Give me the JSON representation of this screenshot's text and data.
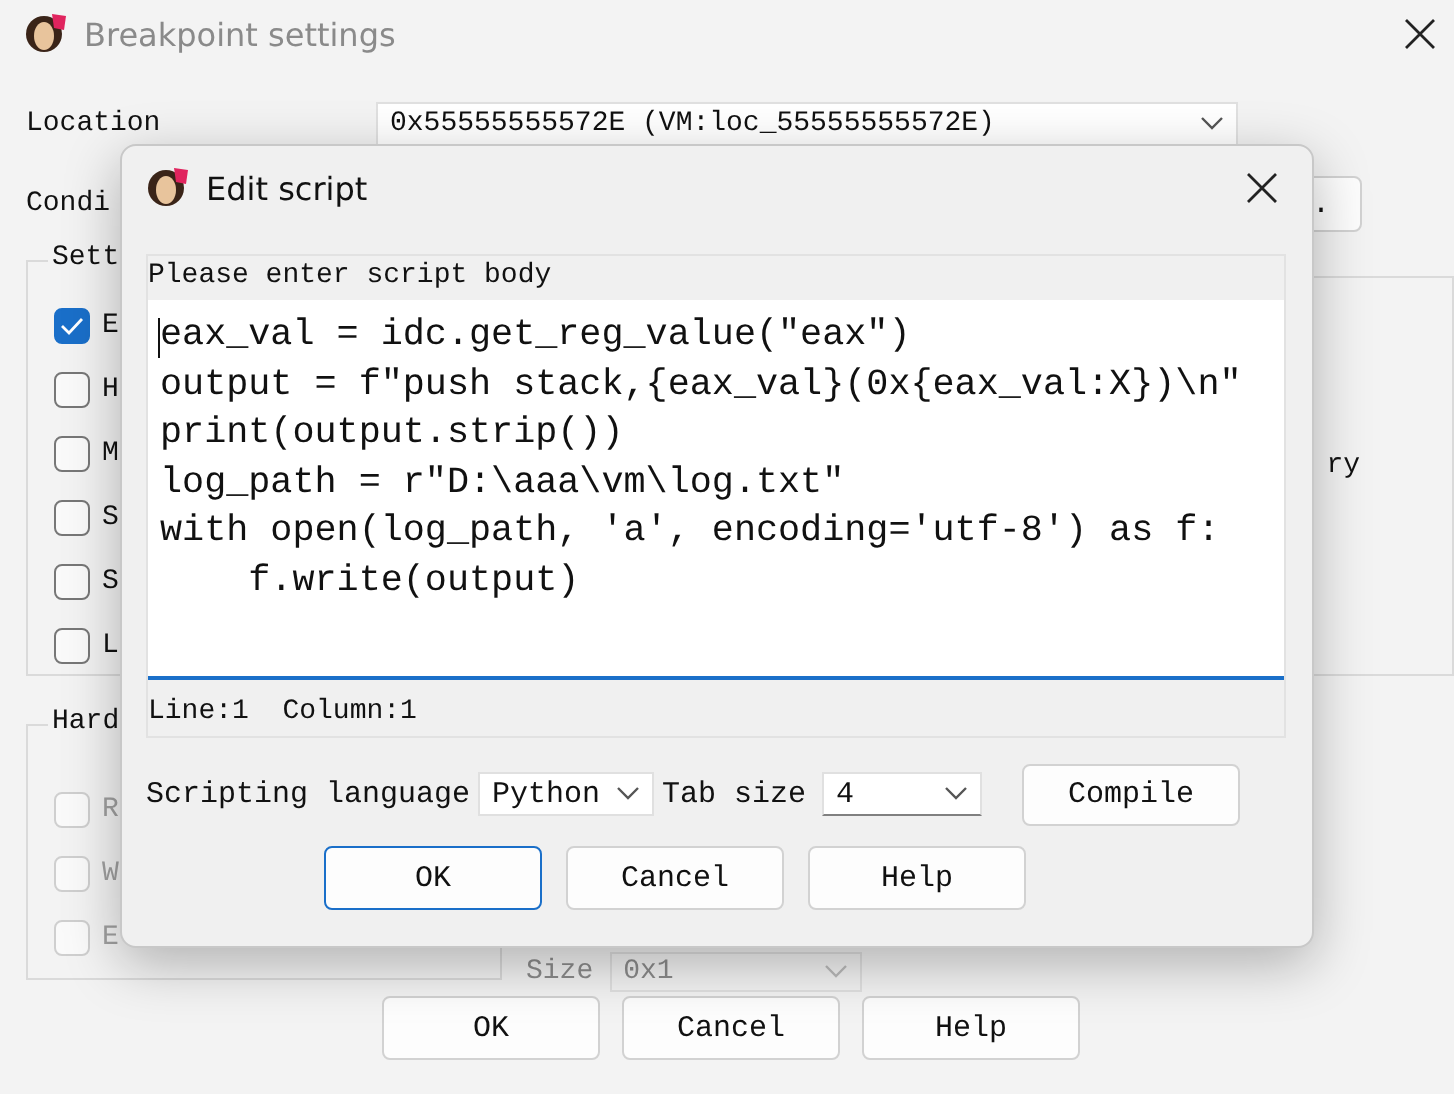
{
  "background_dialog": {
    "title": "Breakpoint settings",
    "location_label": "Location",
    "location_value": "0x55555555572E (VM:loc_55555555572E)",
    "condition_label": "Condi",
    "condition_button": ".",
    "settings_group": {
      "title": "Sett",
      "checkboxes": [
        {
          "label": "E",
          "checked": true
        },
        {
          "label": "H",
          "checked": false
        },
        {
          "label": "M",
          "checked": false
        },
        {
          "label": "S",
          "checked": false
        },
        {
          "label": "S",
          "checked": false
        },
        {
          "label": "L",
          "checked": false
        }
      ]
    },
    "right_group_text": "ry",
    "hardware_group": {
      "title": "Hard",
      "checkboxes": [
        {
          "label": "R",
          "checked": false,
          "disabled": true
        },
        {
          "label": "W",
          "checked": false,
          "disabled": true
        },
        {
          "label": "E",
          "checked": false,
          "disabled": true
        }
      ]
    },
    "size_label": "Size",
    "size_value": "0x1",
    "buttons": [
      "OK",
      "Cancel",
      "Help"
    ]
  },
  "edit_script_dialog": {
    "title": "Edit script",
    "prompt": "Please enter script body",
    "code_lines": [
      "eax_val = idc.get_reg_value(\"eax\")",
      "output = f\"push stack,{eax_val}(0x{eax_val:X})\\n\"",
      "print(output.strip())",
      "log_path = r\"D:\\aaa\\vm\\log.txt\"",
      "with open(log_path, 'a', encoding='utf-8') as f:",
      "    f.write(output)"
    ],
    "status": "Line:1  Column:1",
    "language_label": "Scripting language",
    "language_value": "Python",
    "tab_size_label": "Tab size",
    "tab_size_value": "4",
    "compile_button": "Compile",
    "buttons": [
      {
        "label": "OK",
        "default": true
      },
      {
        "label": "Cancel",
        "default": false
      },
      {
        "label": "Help",
        "default": false
      }
    ]
  }
}
